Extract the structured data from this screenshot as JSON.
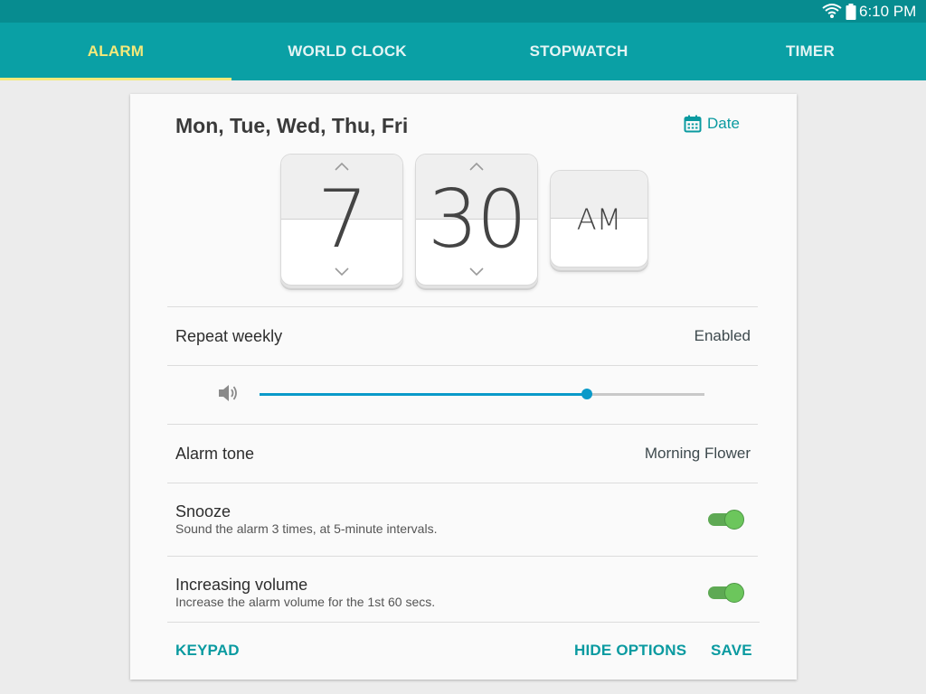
{
  "status_bar": {
    "time": "6:10 PM",
    "icons": [
      "wifi-icon",
      "battery-icon"
    ]
  },
  "tabs": [
    {
      "label": "ALARM",
      "active": true
    },
    {
      "label": "WORLD CLOCK",
      "active": false
    },
    {
      "label": "STOPWATCH",
      "active": false
    },
    {
      "label": "TIMER",
      "active": false
    }
  ],
  "alarm": {
    "days": "Mon, Tue, Wed, Thu, Fri",
    "date_label": "Date",
    "hour": "7",
    "minute": "30",
    "ampm": "AM",
    "repeat": {
      "label": "Repeat weekly",
      "value": "Enabled"
    },
    "volume_fraction": 0.735,
    "tone": {
      "label": "Alarm tone",
      "value": "Morning Flower"
    },
    "snooze": {
      "label": "Snooze",
      "description": "Sound the alarm 3 times, at 5-minute intervals.",
      "on": true
    },
    "increasing_volume": {
      "label": "Increasing volume",
      "description": "Increase the alarm volume for the 1st 60 secs.",
      "on": true
    }
  },
  "footer": {
    "keypad": "KEYPAD",
    "hide_options": "HIDE OPTIONS",
    "save": "SAVE"
  },
  "colors": {
    "status_bar": "#078c90",
    "tab_bar": "#0aa0a5",
    "active_tab": "#f4e97a",
    "accent": "#0a9aa0",
    "slider": "#0a9ac9",
    "toggle_on": "#6cc65c"
  }
}
